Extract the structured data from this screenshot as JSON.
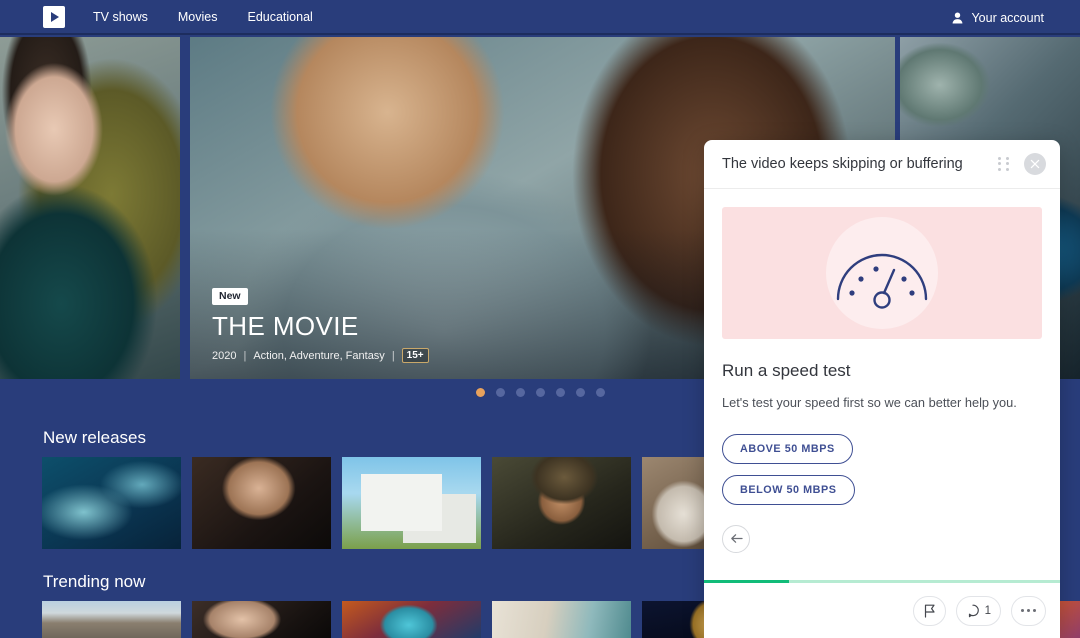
{
  "navbar": {
    "logo_icon": "play-logo-icon",
    "links": [
      {
        "label": "TV shows"
      },
      {
        "label": "Movies"
      },
      {
        "label": "Educational"
      }
    ],
    "account_label": "Your account",
    "account_icon": "user-icon"
  },
  "hero": {
    "badge": "New",
    "title": "THE MOVIE",
    "year": "2020",
    "genres": "Action, Adventure, Fantasy",
    "rating": "15+",
    "separator": "|",
    "carousel": {
      "total_dots": 7,
      "active_index": 0
    }
  },
  "rows": [
    {
      "title": "New releases",
      "items": [
        {
          "art": "t-dolphins"
        },
        {
          "art": "t-man"
        },
        {
          "art": "t-house"
        },
        {
          "art": "t-girl"
        },
        {
          "art": "t-alpaca"
        },
        {
          "art": "t-extra"
        }
      ]
    },
    {
      "title": "Trending now",
      "items": [
        {
          "art": "t-road"
        },
        {
          "art": "t-eyes"
        },
        {
          "art": "t-mask"
        },
        {
          "art": "t-books"
        },
        {
          "art": "t-temple"
        },
        {
          "art": "t-red"
        },
        {
          "art": "t-orange"
        },
        {
          "art": "t-blue"
        }
      ]
    }
  ],
  "widget": {
    "title": "The video keeps skipping or buffering",
    "drag_icon": "drag-handle-icon",
    "close_icon": "close-icon",
    "illustration_icon": "speedometer-icon",
    "heading": "Run a speed test",
    "description": "Let's test your speed first so we can better help you.",
    "choices": [
      {
        "label": "ABOVE 50 MBPS"
      },
      {
        "label": "BELOW 50 MBPS"
      }
    ],
    "back_icon": "arrow-left-icon",
    "progress_percent": 24,
    "footer": {
      "flag_icon": "flag-icon",
      "comment_icon": "comment-icon",
      "comment_count": "1",
      "more_icon": "more-horizontal-icon"
    }
  },
  "colors": {
    "brand_navy": "#293D7B",
    "accent_orange": "#E8A25C",
    "widget_accent": "#3F4F93",
    "progress_green": "#12BC79",
    "illustration_pink": "#FBE0E1"
  }
}
